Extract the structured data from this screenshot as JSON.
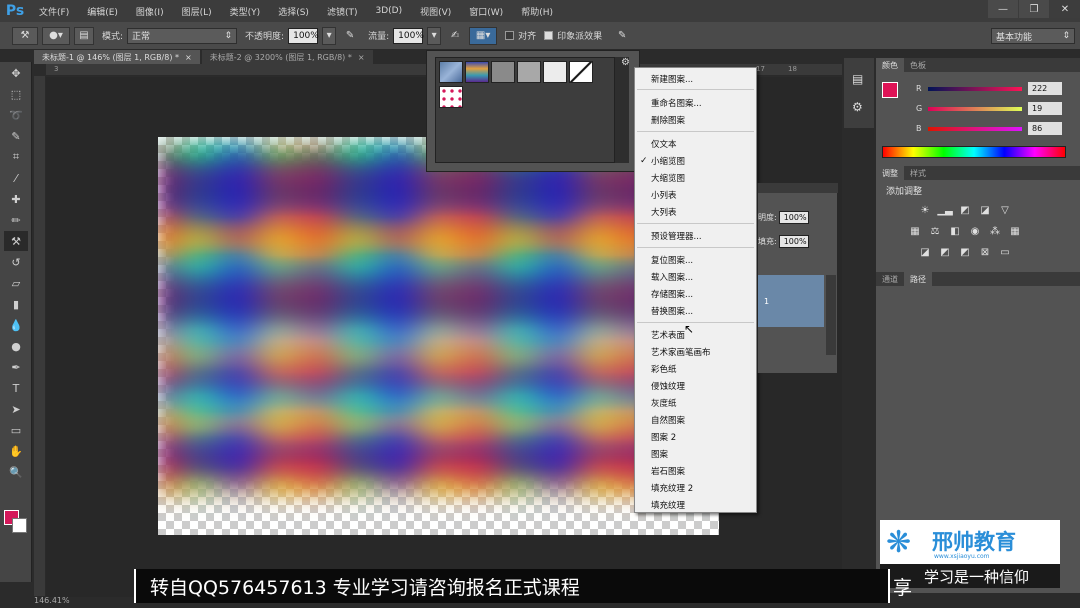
{
  "app": {
    "logo": "Ps"
  },
  "menubar": {
    "items": [
      "文件(F)",
      "编辑(E)",
      "图像(I)",
      "图层(L)",
      "类型(Y)",
      "选择(S)",
      "滤镜(T)",
      "3D(D)",
      "视图(V)",
      "窗口(W)",
      "帮助(H)"
    ]
  },
  "window_controls": {
    "minimize": "—",
    "restore": "❐",
    "close": "✕"
  },
  "options": {
    "mode_label": "模式:",
    "mode_value": "正常",
    "opacity_label": "不透明度:",
    "opacity_value": "100%",
    "flow_label": "流量:",
    "flow_value": "100%",
    "align_label": "对齐",
    "impressionist_label": "印象派效果",
    "workspace": "基本功能"
  },
  "doc_tabs": [
    {
      "label": "未标题-1 @ 146% (图层 1, RGB/8) *"
    },
    {
      "label": "未标题-2 @ 3200% (图层 1, RGB/8) *"
    }
  ],
  "context_menu": {
    "items": [
      {
        "label": "新建图案..."
      },
      {
        "label": "重命名图案..."
      },
      {
        "label": "删除图案"
      },
      {
        "label": "仅文本"
      },
      {
        "label": "小缩览图",
        "checked": true
      },
      {
        "label": "大缩览图"
      },
      {
        "label": "小列表"
      },
      {
        "label": "大列表"
      },
      {
        "label": "预设管理器..."
      },
      {
        "label": "复位图案..."
      },
      {
        "label": "载入图案..."
      },
      {
        "label": "存储图案..."
      },
      {
        "label": "替换图案..."
      },
      {
        "label": "艺术表面"
      },
      {
        "label": "艺术家画笔画布"
      },
      {
        "label": "彩色纸"
      },
      {
        "label": "侵蚀纹理"
      },
      {
        "label": "灰度纸"
      },
      {
        "label": "自然图案"
      },
      {
        "label": "图案 2"
      },
      {
        "label": "图案"
      },
      {
        "label": "岩石图案"
      },
      {
        "label": "填充纹理 2"
      },
      {
        "label": "填充纹理"
      }
    ],
    "check_glyph": "✓"
  },
  "color_panel": {
    "tabs": [
      "颜色",
      "色板"
    ],
    "r_label": "R",
    "g_label": "G",
    "b_label": "B",
    "r": "222",
    "g": "19",
    "b": "86",
    "foreground": "#de1356"
  },
  "adjust_panel": {
    "tabs": [
      "调整",
      "样式"
    ],
    "title": "添加调整"
  },
  "channels_panel": {
    "tabs": [
      "通道",
      "路径"
    ]
  },
  "layers_panel": {
    "opacity_label": "明度:",
    "opacity_value": "100%",
    "fill_label": "填充:",
    "fill_value": "100%",
    "layer_name": "1"
  },
  "subtitle": {
    "text": "转自QQ576457613 专业学习请咨询报名正式课程"
  },
  "subtitle_tail": "享",
  "brand": {
    "name": "邢帅教育",
    "url": "www.xsjiaoyu.com",
    "slogan": "学习是一种信仰"
  },
  "status": {
    "zoom": "146.41%"
  }
}
